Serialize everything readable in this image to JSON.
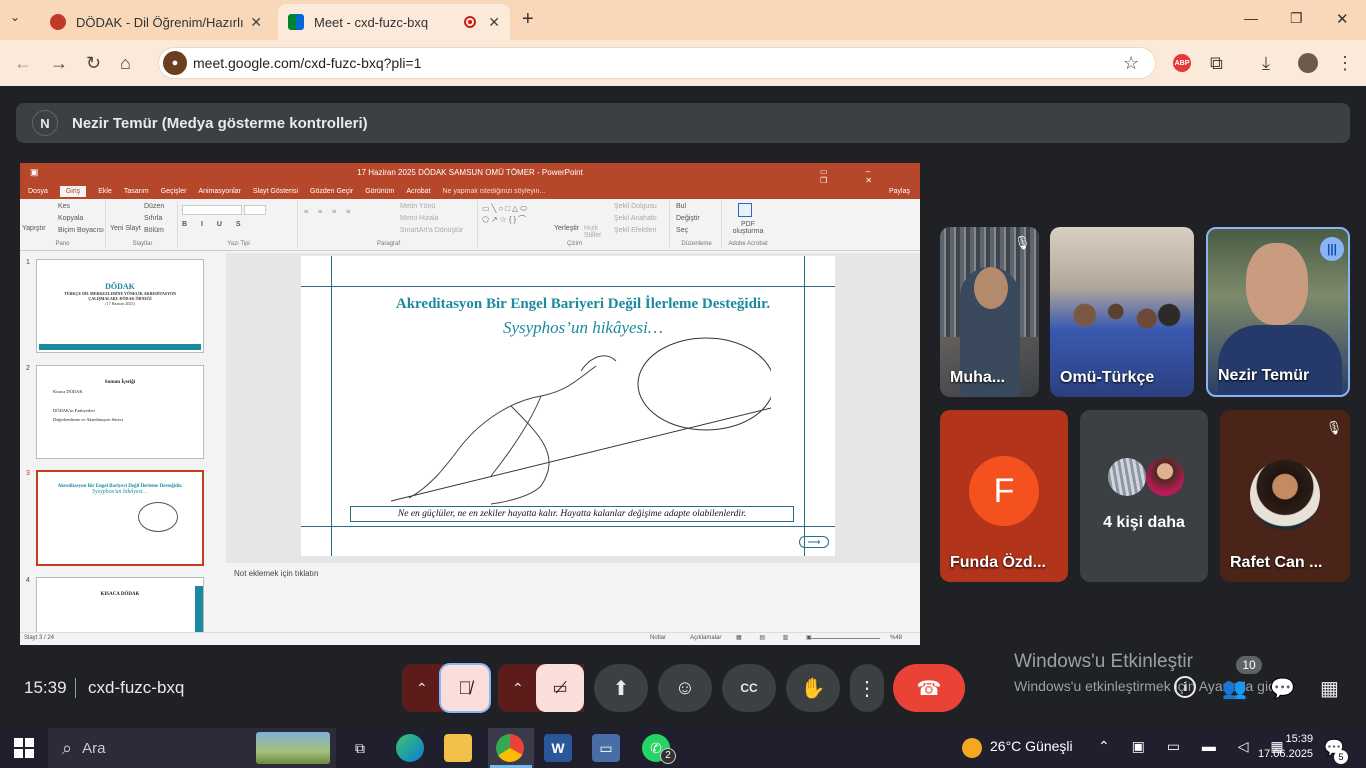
{
  "browser": {
    "tabs": [
      {
        "title": "DÖDAK - Dil Öğrenim/Hazırlık Me",
        "active": false
      },
      {
        "title": "Meet - cxd-fuzc-bxq",
        "active": true
      }
    ],
    "url": "meet.google.com/cxd-fuzc-bxq?pli=1",
    "new_tab": "+",
    "minimize": "—",
    "maximize": "❐",
    "close": "✕"
  },
  "meet": {
    "presenter_initial": "N",
    "presenter_label": "Nezir Temür (Medya gösterme kontrolleri)",
    "clock": "15:39",
    "meeting_code": "cxd-fuzc-bxq",
    "participant_count": "10",
    "participants": [
      {
        "name": "Muha..."
      },
      {
        "name": "Omü-Türkçe"
      },
      {
        "name": "Nezir Temür"
      },
      {
        "initial": "F",
        "name": "Funda Özd..."
      },
      {
        "name": "4 kişi daha"
      },
      {
        "name": "Rafet Can ..."
      }
    ],
    "colors": {
      "leave": "#ea4335",
      "mic_off_bg": "#f9dedc",
      "accent": "#8ab4f8"
    }
  },
  "windows_activation": {
    "title": "Windows'u Etkinleştir",
    "subtitle": "Windows'u etkinleştirmek için Ayarlar'a gidin."
  },
  "ppt": {
    "title": "17 Haziran 2025  DÖDAK SAMSUN OMÜ TÖMER  -  PowerPoint",
    "share": "Paylaş",
    "menu": [
      "Dosya",
      "Giriş",
      "Ekle",
      "Tasarım",
      "Geçişler",
      "Animasyonlar",
      "Slayt Gösterisi",
      "Gözden Geçir",
      "Görünüm",
      "Acrobat"
    ],
    "tell_me": "Ne yapmak istediğinizi söyleyin...",
    "ribbon_groups": [
      "Pano",
      "Slaytlar",
      "Yazı Tipi",
      "Paragraf",
      "Çizim",
      "Düzenleme",
      "Adobe Acrobat"
    ],
    "ribbon_items": {
      "paste": "Yapıştır",
      "cut": "Kes",
      "copy": "Kopyala",
      "format_painter": "Biçim Boyacısı",
      "new_slide": "Yeni Slayt",
      "layout": "Düzen",
      "reset": "Sıfırla",
      "section": "Bölüm",
      "text_direction": "Metin Yönü",
      "align_text": "Metni Hizala",
      "smartart": "SmartArt'a Dönüştür",
      "arrange": "Yerleştir",
      "quick_styles": "Hızlı Stiller",
      "shape_fill": "Şekil Dolgusu",
      "shape_outline": "Şekil Anahattı",
      "shape_effects": "Şekil Efektleri",
      "find": "Bul",
      "replace": "Değiştir",
      "select": "Seç",
      "pdf": "PDF oluşturma"
    },
    "thumbnails": [
      {
        "num": "1",
        "title": "DÖDAK",
        "subtitle": "TÜRKÇE DİL MERKEZLERİNE YÖNELİK AKREDİTASYON ÇALIŞMALARI: DÖDAK ÖRNEĞİ",
        "date": "(17 Haziran 2025)"
      },
      {
        "num": "2",
        "title": "Sunum İçeriği",
        "items": [
          "Kısaca DÖDAK",
          "DÖDAK'ın Faaliyetleri",
          "Değerlendirme ve Akreditasyon Süreci"
        ]
      },
      {
        "num": "3",
        "title": "Akreditasyon Bir Engel Bariyeri Değil İlerleme Desteğidir.",
        "subtitle": "Sysyphos'un hikâyesi…"
      },
      {
        "num": "4",
        "title": "KISACA DÖDAK"
      }
    ],
    "slide": {
      "title": "Akreditasyon Bir Engel Bariyeri Değil İlerleme Desteğidir.",
      "subtitle": "Sysyphos’un hikâyesi…",
      "quote": "Ne en güçlüler, ne en zekiler hayatta kalır. Hayatta kalanlar değişime adapte olabilenlerdir."
    },
    "notes_placeholder": "Not eklemek için tıklatın",
    "status": {
      "slide_counter": "Slayt 3 / 24",
      "notes": "Notlar",
      "comments": "Açıklamalar",
      "zoom": "%48"
    }
  },
  "taskbar": {
    "search_placeholder": "Ara",
    "weather": "26°C  Güneşli",
    "time": "15:39",
    "date": "17.06.2025",
    "notifications": "5",
    "whatsapp_badge": "2"
  }
}
